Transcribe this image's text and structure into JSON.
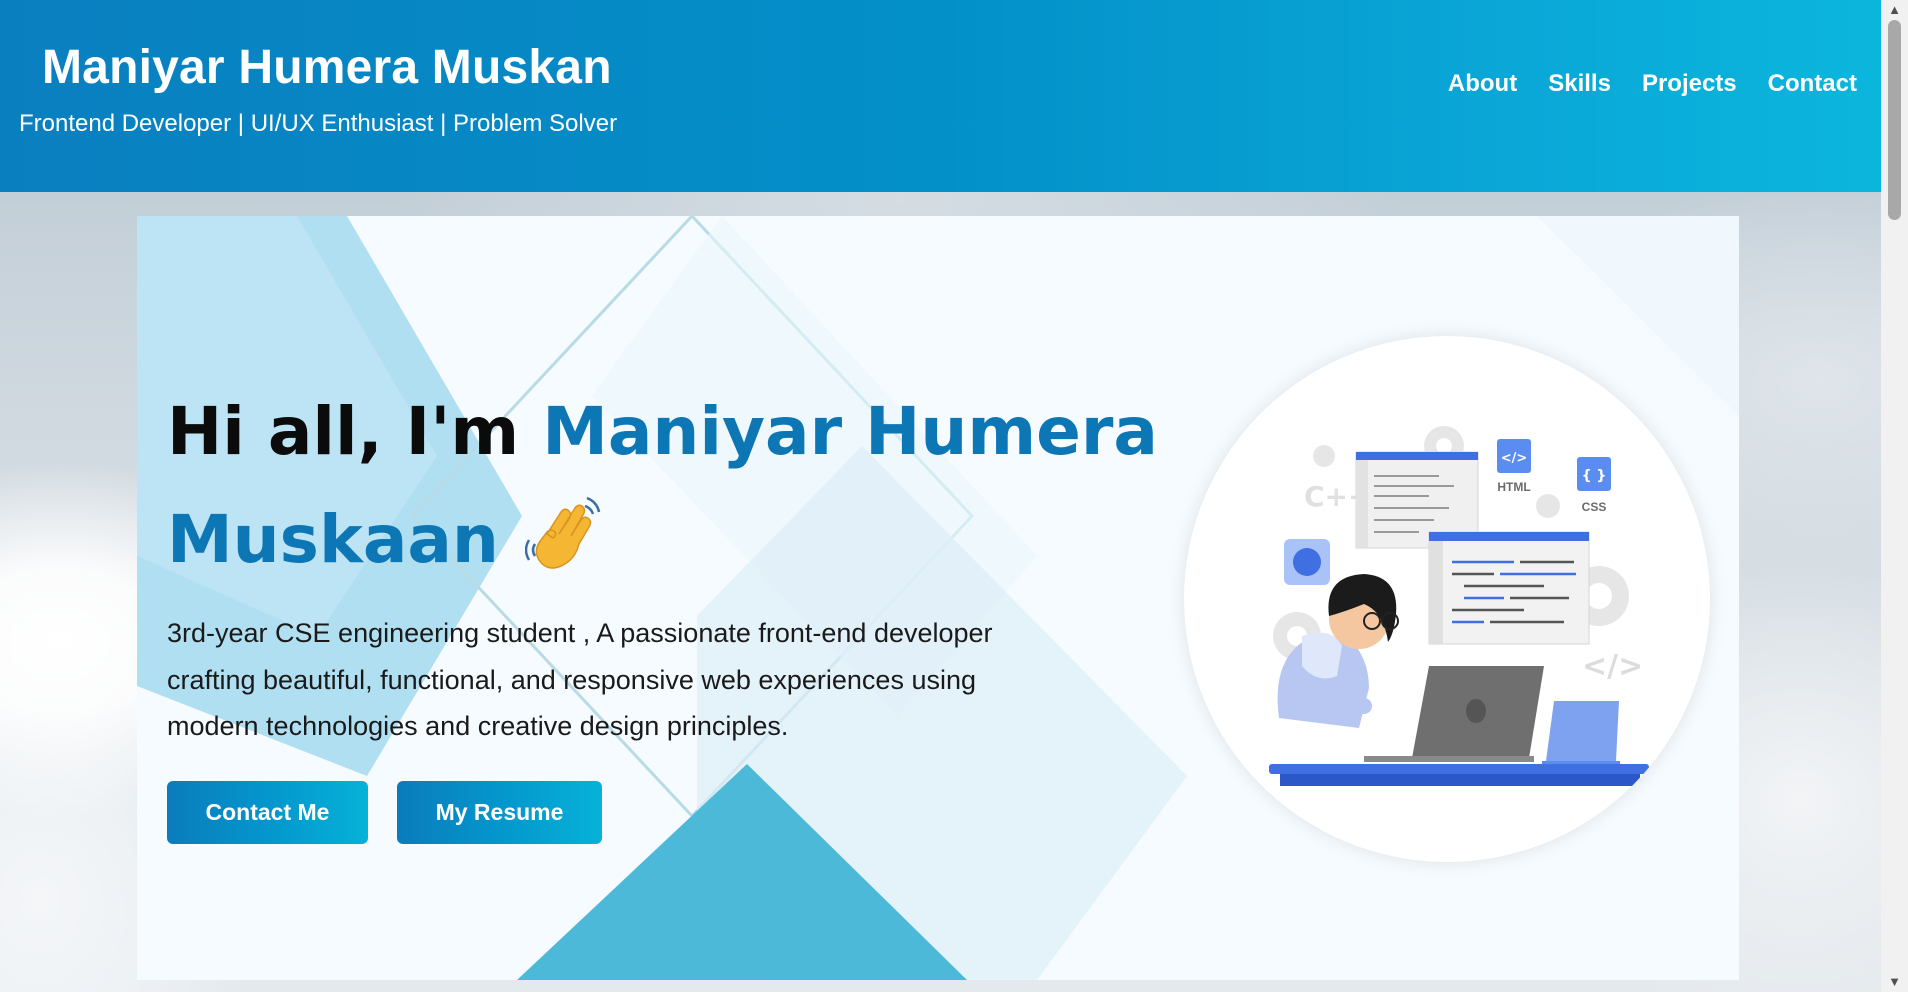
{
  "header": {
    "name": "Maniyar Humera Muskan",
    "tagline": "Frontend Developer | UI/UX Enthusiast | Problem Solver",
    "nav": [
      {
        "label": "About"
      },
      {
        "label": "Skills"
      },
      {
        "label": "Projects"
      },
      {
        "label": "Contact"
      }
    ]
  },
  "hero": {
    "greeting": "Hi all, I'm ",
    "name": "Maniyar Humera Muskaan",
    "wave_icon": "waving-hand-icon",
    "description": "3rd-year CSE engineering student , A passionate front-end developer crafting beautiful, functional, and responsive web experiences using modern technologies and creative design principles.",
    "buttons": {
      "contact": "Contact Me",
      "resume": "My Resume"
    },
    "illustration": {
      "labels": {
        "html": "HTML",
        "css": "CSS",
        "cpp": "C++",
        "html_symbol": "</>",
        "css_symbol": "{ }",
        "code_symbol": "</>"
      }
    }
  },
  "colors": {
    "header_start": "#0a7fc0",
    "header_end": "#0bb6dd",
    "accent_text": "#0d76b4",
    "button": "#0496cc"
  }
}
